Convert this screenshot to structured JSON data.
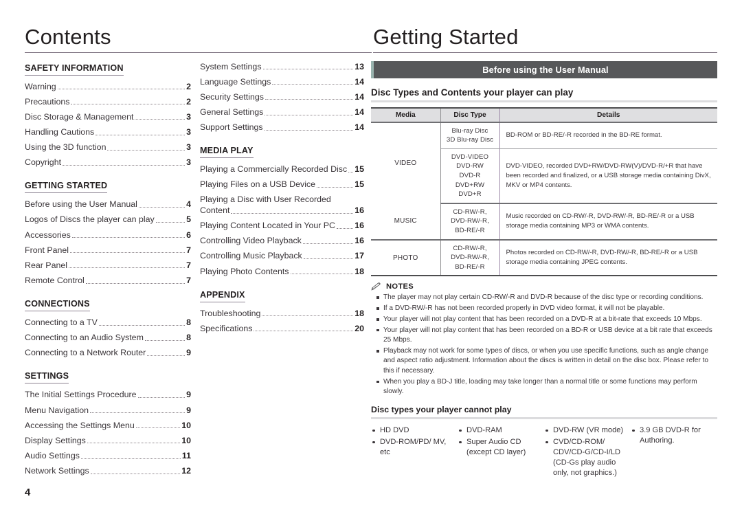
{
  "left": {
    "title": "Contents",
    "columns": [
      {
        "sections": [
          {
            "heading": "SAFETY INFORMATION",
            "entries": [
              {
                "label": "Warning",
                "page": "2"
              },
              {
                "label": "Precautions",
                "page": "2"
              },
              {
                "label": "Disc Storage & Management",
                "page": "3"
              },
              {
                "label": "Handling Cautions",
                "page": "3"
              },
              {
                "label": "Using the 3D function",
                "page": "3"
              },
              {
                "label": "Copyright",
                "page": "3"
              }
            ]
          },
          {
            "heading": "GETTING STARTED",
            "entries": [
              {
                "label": "Before using the User Manual",
                "page": "4"
              },
              {
                "label": "Logos of Discs the player can play",
                "page": "5"
              },
              {
                "label": "Accessories",
                "page": "6"
              },
              {
                "label": "Front Panel",
                "page": "7"
              },
              {
                "label": "Rear Panel",
                "page": "7"
              },
              {
                "label": "Remote Control",
                "page": "7"
              }
            ]
          },
          {
            "heading": "CONNECTIONS",
            "entries": [
              {
                "label": "Connecting to a TV",
                "page": "8"
              },
              {
                "label": "Connecting to an Audio System",
                "page": "8"
              },
              {
                "label": "Connecting to a Network Router",
                "page": "9"
              }
            ]
          },
          {
            "heading": "SETTINGS",
            "entries": [
              {
                "label": "The Initial Settings Procedure",
                "page": "9"
              },
              {
                "label": "Menu Navigation",
                "page": "9"
              },
              {
                "label": "Accessing the Settings Menu",
                "page": "10"
              },
              {
                "label": "Display Settings",
                "page": "10"
              },
              {
                "label": "Audio Settings",
                "page": "11"
              },
              {
                "label": "Network Settings",
                "page": "12"
              }
            ]
          }
        ]
      },
      {
        "sections": [
          {
            "heading": "",
            "entries": [
              {
                "label": "System Settings",
                "page": "13"
              },
              {
                "label": "Language Settings",
                "page": "14"
              },
              {
                "label": "Security Settings",
                "page": "14"
              },
              {
                "label": "General Settings",
                "page": "14"
              },
              {
                "label": "Support Settings",
                "page": "14"
              }
            ]
          },
          {
            "heading": "MEDIA PLAY",
            "entries": [
              {
                "label": "Playing a Commercially Recorded Disc",
                "page": "15"
              },
              {
                "label": "Playing Files on a USB Device",
                "page": "15"
              },
              {
                "label": "Playing a Disc with User Recorded",
                "label2": "Content",
                "page": "16",
                "wrap": true
              },
              {
                "label": "Playing Content Located in Your PC",
                "page": "16"
              },
              {
                "label": "Controlling Video Playback",
                "page": "16"
              },
              {
                "label": "Controlling Music Playback",
                "page": "17"
              },
              {
                "label": "Playing Photo Contents",
                "page": "18"
              }
            ]
          },
          {
            "heading": "APPENDIX",
            "entries": [
              {
                "label": "Troubleshooting",
                "page": "18"
              },
              {
                "label": "Specifications",
                "page": "20"
              }
            ]
          }
        ]
      }
    ]
  },
  "right": {
    "title": "Getting Started",
    "banner": "Before using the User Manual",
    "disc_types_heading": "Disc Types and Contents your player can play",
    "table": {
      "headers": [
        "Media",
        "Disc Type",
        "Details"
      ],
      "rows": [
        {
          "media": "VIDEO",
          "groups": [
            {
              "types": [
                "Blu-ray Disc",
                "3D Blu-ray Disc"
              ],
              "details": "BD-ROM or BD-RE/-R recorded in the BD-RE format."
            },
            {
              "types": [
                "DVD-VIDEO",
                "DVD-RW",
                "DVD-R",
                "DVD+RW",
                "DVD+R"
              ],
              "details": "DVD-VIDEO, recorded DVD+RW/DVD-RW(V)/DVD-R/+R that have been recorded and finalized, or a USB storage media containing DivX, MKV or MP4 contents."
            }
          ]
        },
        {
          "media": "MUSIC",
          "groups": [
            {
              "types": [
                "CD-RW/-R,",
                "DVD-RW/-R,",
                "BD-RE/-R"
              ],
              "details": "Music recorded on CD-RW/-R, DVD-RW/-R, BD-RE/-R or a USB storage media containing MP3 or WMA contents."
            }
          ]
        },
        {
          "media": "PHOTO",
          "groups": [
            {
              "types": [
                "CD-RW/-R,",
                "DVD-RW/-R,",
                "BD-RE/-R"
              ],
              "details": "Photos recorded on CD-RW/-R, DVD-RW/-R, BD-RE/-R or a USB storage media containing JPEG contents."
            }
          ]
        }
      ]
    },
    "notes": {
      "title": "NOTES",
      "icon": "pencil-icon",
      "items": [
        "The player may not play certain CD-RW/-R and DVD-R because of the disc type or recording conditions.",
        "If a DVD-RW/-R has not been recorded properly in DVD video format, it will not be playable.",
        "Your player will not play content that has been recorded on a DVD-R at a bit-rate that exceeds 10 Mbps.",
        "Your player will not play content that has been recorded on a BD-R or USB device at a bit rate that exceeds 25 Mbps.",
        "Playback may not work for some types of discs, or when you use specific functions, such as angle change and aspect ratio adjustment. Information about the discs is written in detail on the disc box. Please refer to this if necessary.",
        "When you play a BD-J title, loading may take longer than a normal title or some functions may perform slowly."
      ]
    },
    "cannot_play": {
      "heading": "Disc types your player cannot play",
      "columns": [
        [
          "HD DVD",
          "DVD-ROM/PD/ MV, etc"
        ],
        [
          "DVD-RAM",
          "Super Audio CD (except CD layer)"
        ],
        [
          "DVD-RW (VR mode)",
          "CVD/CD-ROM/ CDV/CD-G/CD-I/LD (CD-Gs play audio only, not graphics.)"
        ],
        [
          "3.9 GB DVD-R for Authoring."
        ]
      ]
    }
  },
  "footer": {
    "page_number": "4"
  },
  "colors": {
    "text": "#231f20",
    "body_text": "#3a3539",
    "banner_bg": "#57585a",
    "banner_accent": "#99b3ae",
    "table_header_bg": "#dfdfe1",
    "rule": "#8c8392",
    "sub_rule": "#dcdcde",
    "col_divider_purple": "#9a86a6"
  }
}
